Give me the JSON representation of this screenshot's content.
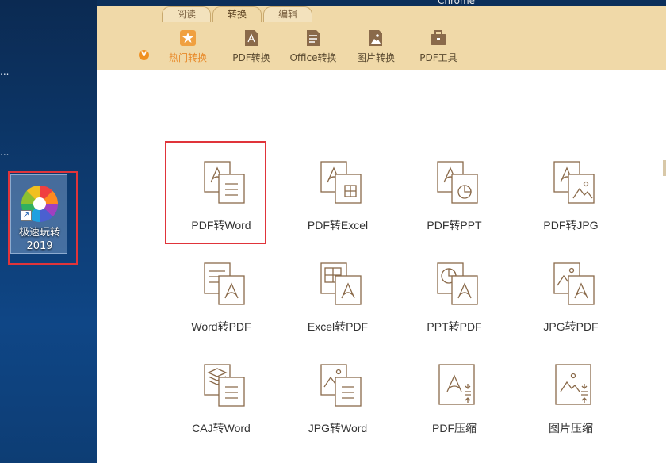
{
  "window": {
    "chrome_title": "Chrome"
  },
  "desktop": {
    "dots": [
      "...",
      "..."
    ],
    "shortcut": {
      "label_line1": "极速玩转",
      "label_line2": "2019",
      "arrow": "↗"
    }
  },
  "tabs": [
    {
      "label": "阅读",
      "active": false
    },
    {
      "label": "转换",
      "active": true
    },
    {
      "label": "编辑",
      "active": false
    }
  ],
  "toolbar": {
    "badge": "V",
    "items": [
      {
        "label": "热门转换",
        "icon": "star-icon",
        "active": true
      },
      {
        "label": "PDF转换",
        "icon": "pdf-icon",
        "active": false
      },
      {
        "label": "Office转换",
        "icon": "document-icon",
        "active": false
      },
      {
        "label": "图片转换",
        "icon": "image-icon",
        "active": false
      },
      {
        "label": "PDF工具",
        "icon": "toolbox-icon",
        "active": false
      }
    ]
  },
  "grid": [
    {
      "label": "PDF转Word",
      "icon": "pdf-to-word-icon"
    },
    {
      "label": "PDF转Excel",
      "icon": "pdf-to-excel-icon"
    },
    {
      "label": "PDF转PPT",
      "icon": "pdf-to-ppt-icon"
    },
    {
      "label": "PDF转JPG",
      "icon": "pdf-to-jpg-icon"
    },
    {
      "label": "Word转PDF",
      "icon": "word-to-pdf-icon"
    },
    {
      "label": "Excel转PDF",
      "icon": "excel-to-pdf-icon"
    },
    {
      "label": "PPT转PDF",
      "icon": "ppt-to-pdf-icon"
    },
    {
      "label": "JPG转PDF",
      "icon": "jpg-to-pdf-icon"
    },
    {
      "label": "CAJ转Word",
      "icon": "caj-to-word-icon"
    },
    {
      "label": "JPG转Word",
      "icon": "jpg-to-word-icon"
    },
    {
      "label": "PDF压缩",
      "icon": "pdf-compress-icon"
    },
    {
      "label": "图片压缩",
      "icon": "image-compress-icon"
    }
  ],
  "colors": {
    "toolbar_bg": "#f0d9a8",
    "accent": "#e88a2a",
    "icon_stroke": "#8a6a4a",
    "highlight": "#e0343a"
  }
}
